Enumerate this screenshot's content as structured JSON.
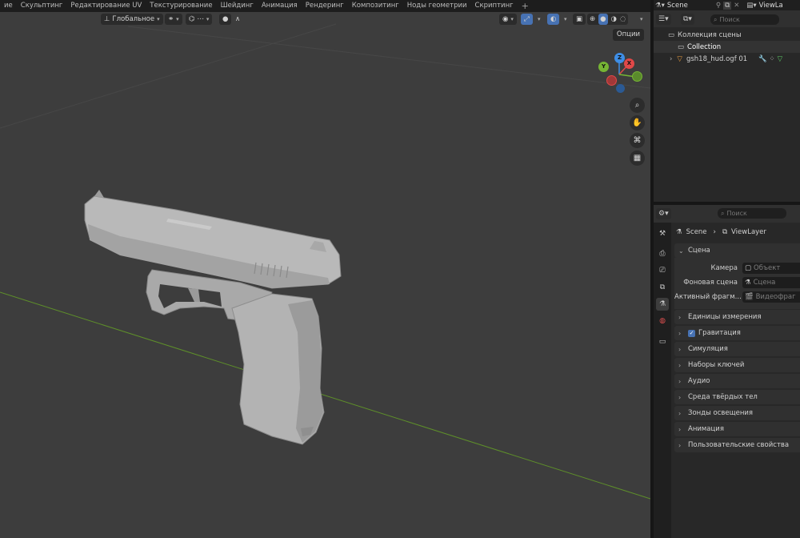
{
  "workspace_tabs": [
    "ие",
    "Скульптинг",
    "Редактирование UV",
    "Текстурирование",
    "Шейдинг",
    "Анимация",
    "Рендеринг",
    "Композитинг",
    "Ноды геометрии",
    "Скриптинг",
    "+"
  ],
  "viewport": {
    "orientation_label": "Глобальное",
    "options_label": "Опции",
    "gizmo": {
      "x": "X",
      "y": "Y",
      "z": "Z"
    }
  },
  "outliner": {
    "scene_name": "Scene",
    "view_layer": "ViewLa",
    "search_placeholder": "Поиск",
    "rows": {
      "scene_collection": "Коллекция сцены",
      "collection": "Collection",
      "object": "gsh18_hud.ogf 01"
    }
  },
  "properties": {
    "search_placeholder": "Поиск",
    "breadcrumb": {
      "scene": "Scene",
      "view_layer": "ViewLayer"
    },
    "scene_panel": {
      "title": "Сцена",
      "camera_label": "Камера",
      "camera_placeholder": "Объект",
      "background_label": "Фоновая сцена",
      "background_placeholder": "Сцена",
      "active_clip_label": "Активный фрагм...",
      "active_clip_placeholder": "Видеофраг"
    },
    "panels": [
      "Единицы измерения",
      "Гравитация",
      "Симуляция",
      "Наборы ключей",
      "Аудио",
      "Среда твёрдых тел",
      "Зонды освещения",
      "Анимация",
      "Пользовательские свойства"
    ],
    "gravity_checked": true
  },
  "colors": {
    "accent": "#4772b3",
    "x_axis": "#e14848",
    "y_axis": "#76b534",
    "z_axis": "#3e8ee6"
  }
}
